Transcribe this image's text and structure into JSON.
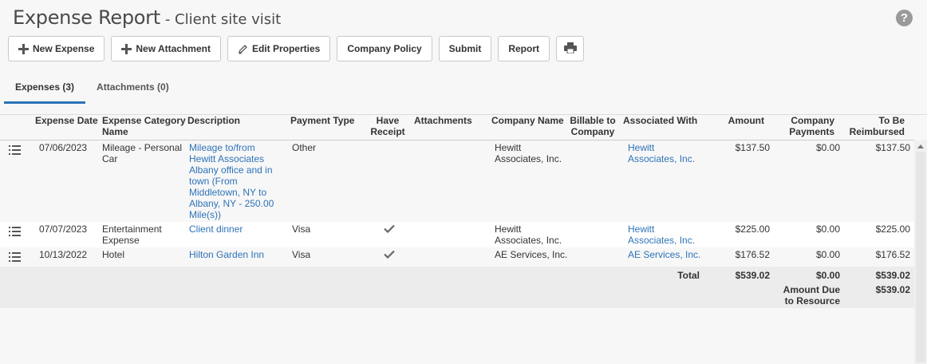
{
  "header": {
    "title": "Expense Report",
    "subtitle": "- Client site visit",
    "help_label": "?"
  },
  "toolbar": {
    "new_expense": "New Expense",
    "new_attachment": "New Attachment",
    "edit_properties": "Edit Properties",
    "company_policy": "Company Policy",
    "submit": "Submit",
    "report": "Report"
  },
  "tabs": [
    {
      "label": "Expenses (3)"
    },
    {
      "label": "Attachments (0)"
    }
  ],
  "columns": {
    "expense_date": "Expense Date",
    "category_1": "Expense Category",
    "category_2": "Name",
    "description": "Description",
    "payment_type": "Payment Type",
    "have_receipt_1": "Have",
    "have_receipt_2": "Receipt",
    "attachments": "Attachments",
    "company_name": "Company Name",
    "billable_1": "Billable to",
    "billable_2": "Company",
    "associated_with": "Associated With",
    "amount": "Amount",
    "company_payments_1": "Company",
    "company_payments_2": "Payments",
    "to_be_reimbursed_1": "To Be",
    "to_be_reimbursed_2": "Reimbursed"
  },
  "rows": [
    {
      "date": "07/06/2023",
      "category": [
        "Mileage - Personal",
        "Car"
      ],
      "description": [
        "Mileage to/from",
        "Hewitt Associates",
        "Albany office and in",
        "town (From",
        "Middletown, NY to",
        "Albany, NY - 250.00",
        "Mile(s))"
      ],
      "payment_type": "Other",
      "have_receipt": false,
      "company_name": [
        "Hewitt",
        "Associates, Inc."
      ],
      "associated_with": [
        "Hewitt",
        "Associates, Inc."
      ],
      "amount": "$137.50",
      "company_payments": "$0.00",
      "to_be_reimbursed": "$137.50"
    },
    {
      "date": "07/07/2023",
      "category": [
        "Entertainment",
        "Expense"
      ],
      "description": [
        "Client dinner"
      ],
      "payment_type": "Visa",
      "have_receipt": true,
      "company_name": [
        "Hewitt",
        "Associates, Inc."
      ],
      "associated_with": [
        "Hewitt",
        "Associates, Inc."
      ],
      "amount": "$225.00",
      "company_payments": "$0.00",
      "to_be_reimbursed": "$225.00"
    },
    {
      "date": "10/13/2022",
      "category": [
        "Hotel"
      ],
      "description": [
        "Hilton Garden Inn"
      ],
      "payment_type": "Visa",
      "have_receipt": true,
      "company_name": [
        "AE Services, Inc."
      ],
      "associated_with": [
        "AE Services, Inc."
      ],
      "amount": "$176.52",
      "company_payments": "$0.00",
      "to_be_reimbursed": "$176.52"
    }
  ],
  "totals": {
    "total_label": "Total",
    "amount": "$539.02",
    "company_payments": "$0.00",
    "to_be_reimbursed": "$539.02",
    "amount_due_label_1": "Amount Due",
    "amount_due_label_2": "to Resource",
    "amount_due": "$539.02"
  },
  "colors": {
    "link": "#2e73b8",
    "tab_underline": "#2e73b8"
  }
}
